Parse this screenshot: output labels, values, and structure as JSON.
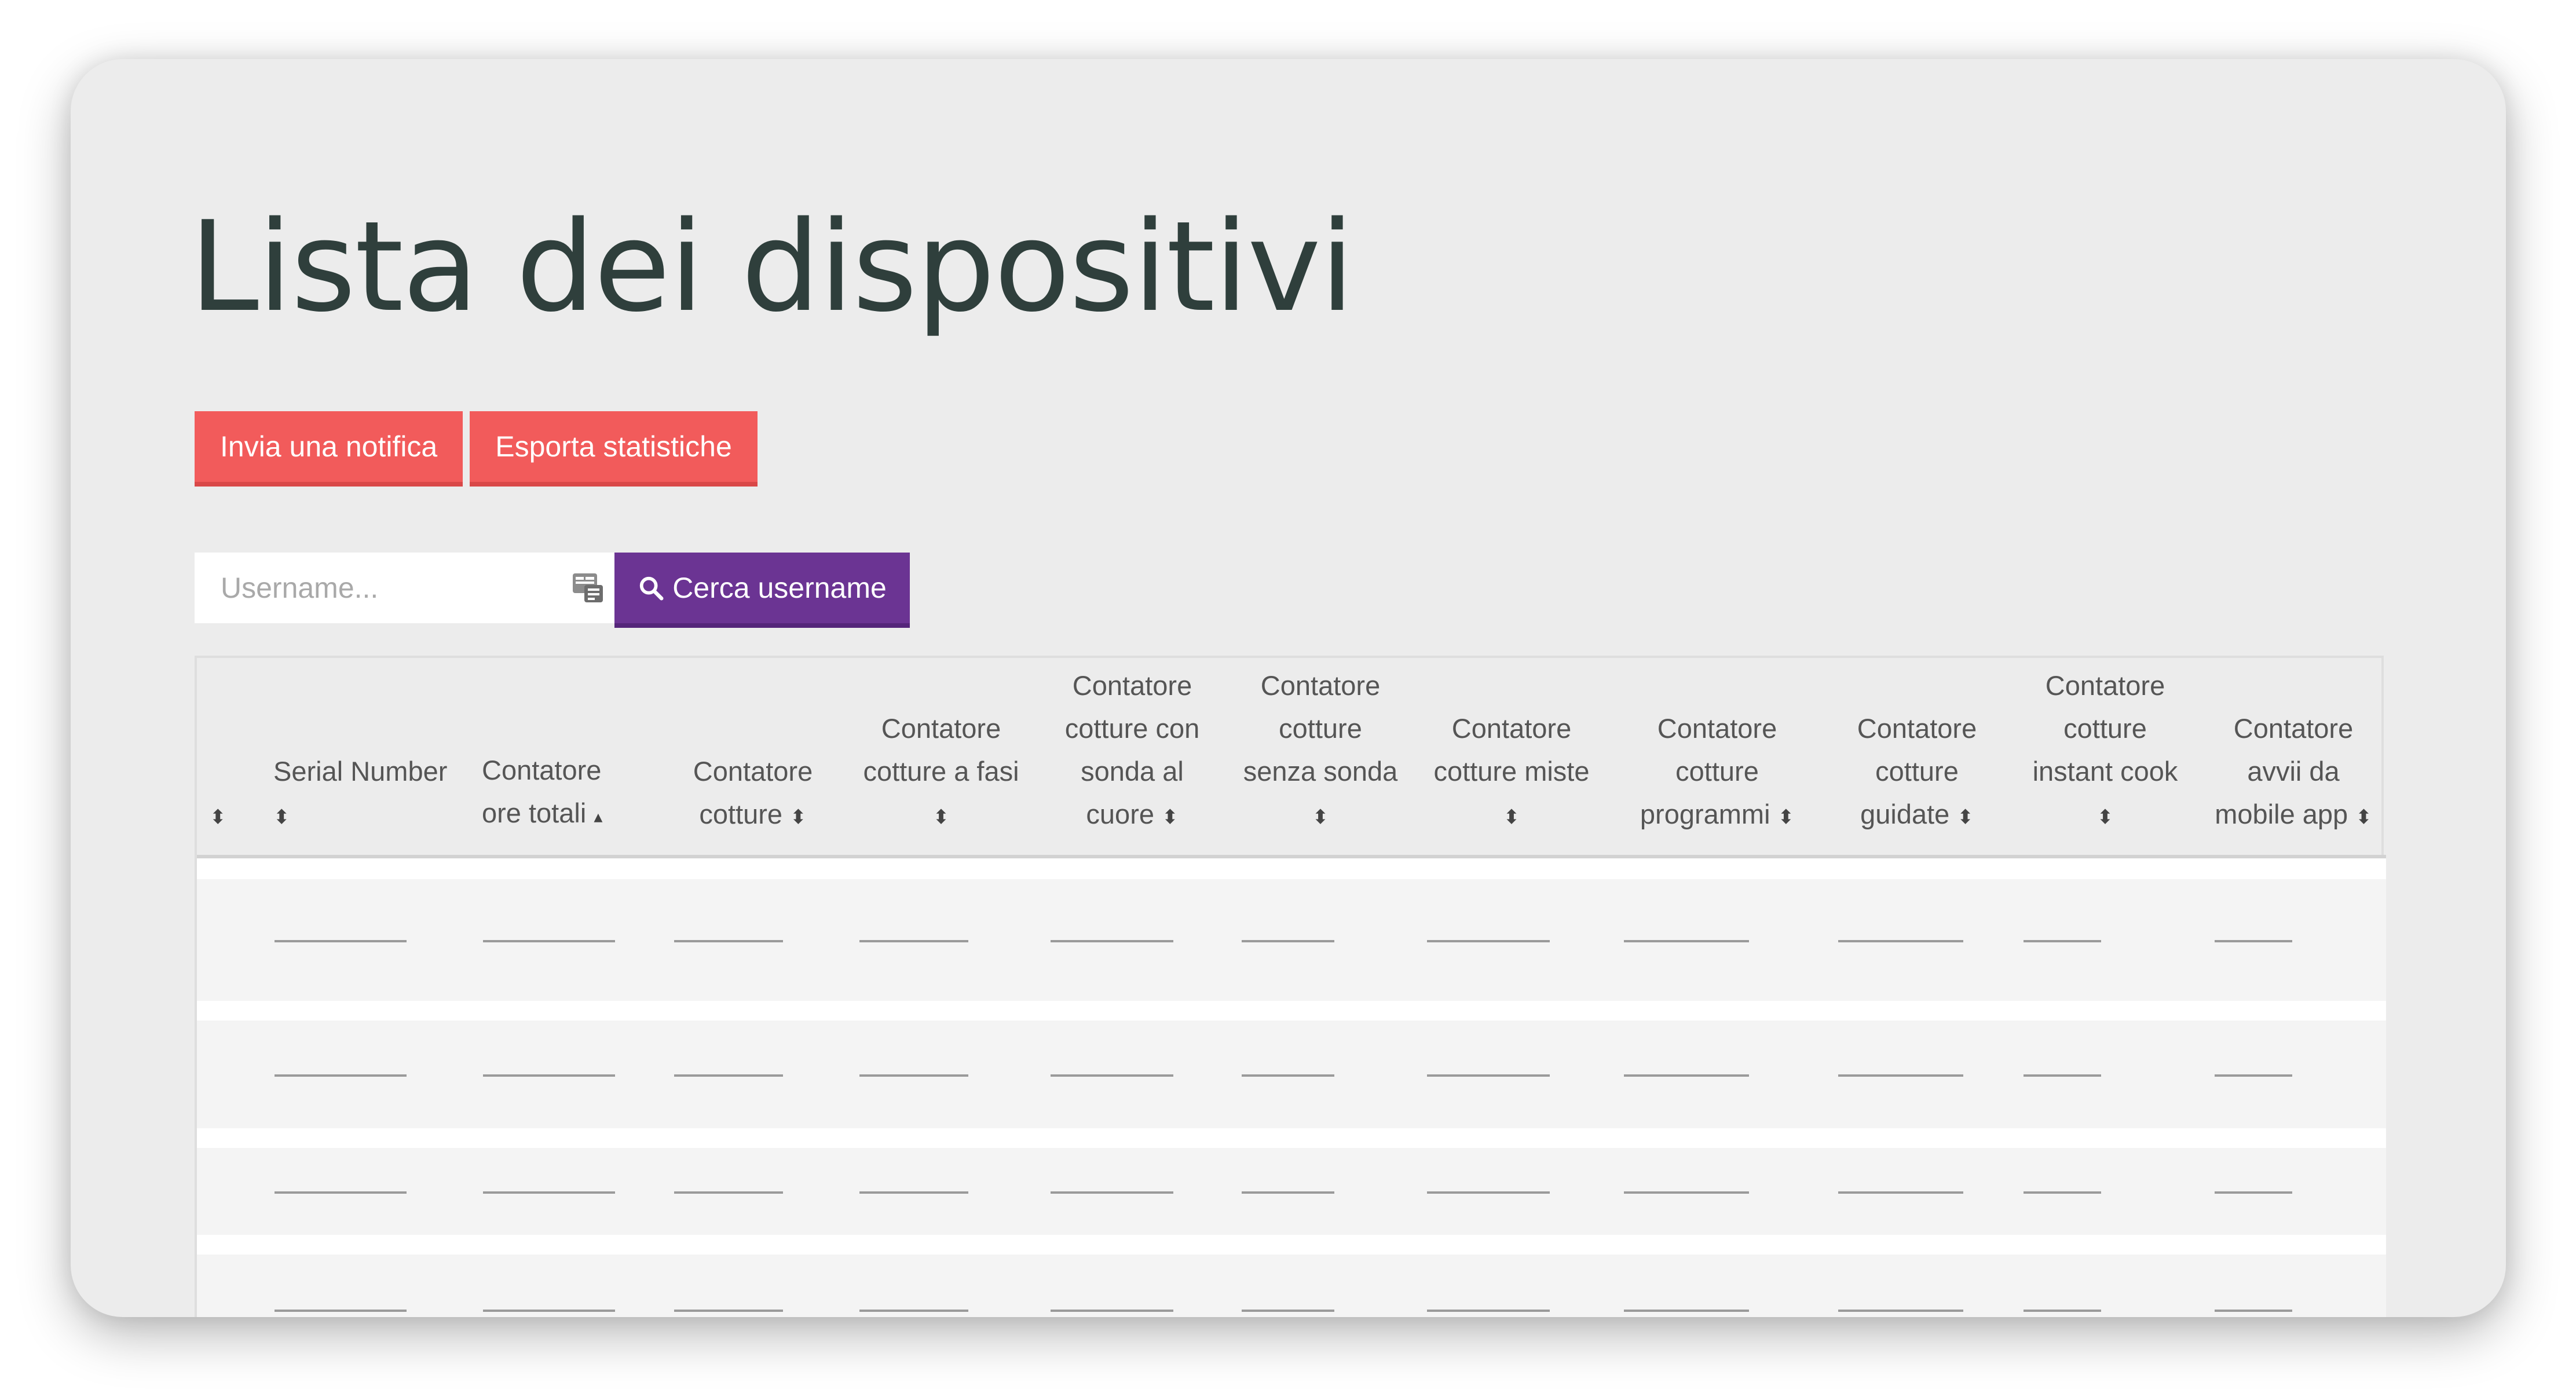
{
  "page": {
    "title": "Lista dei dispositivi"
  },
  "actions": {
    "notify_label": "Invia una notifica",
    "export_label": "Esporta statistiche"
  },
  "search": {
    "placeholder": "Username...",
    "value": "",
    "button_label": "Cerca username"
  },
  "table": {
    "columns": [
      {
        "label": "",
        "sort": "both"
      },
      {
        "label": "Serial Number",
        "sort": "both"
      },
      {
        "label": "Contatore ore totali",
        "sort": "asc"
      },
      {
        "label": "Contatore cotture",
        "sort": "both"
      },
      {
        "label": "Contatore cotture a fasi",
        "sort": "both"
      },
      {
        "label": "Contatore cotture con sonda al cuore",
        "sort": "both"
      },
      {
        "label": "Contatore cotture senza sonda",
        "sort": "both"
      },
      {
        "label": "Contatore cotture miste",
        "sort": "both"
      },
      {
        "label": "Contatore cotture programmi",
        "sort": "both"
      },
      {
        "label": "Contatore cotture guidate",
        "sort": "both"
      },
      {
        "label": "Contatore cotture instant cook",
        "sort": "both"
      },
      {
        "label": "Contatore avvii da mobile app",
        "sort": "both"
      }
    ],
    "row_count_visible": 4
  },
  "colors": {
    "primary_red": "#f25b5b",
    "primary_purple": "#6b3493",
    "title_text": "#2f3f3c",
    "card_bg": "#ececec"
  },
  "icons": {
    "search_button": "search-icon",
    "field_addon": "contact-card-icon",
    "sort_both": "sort-icon",
    "sort_asc": "sort-asc-icon"
  }
}
